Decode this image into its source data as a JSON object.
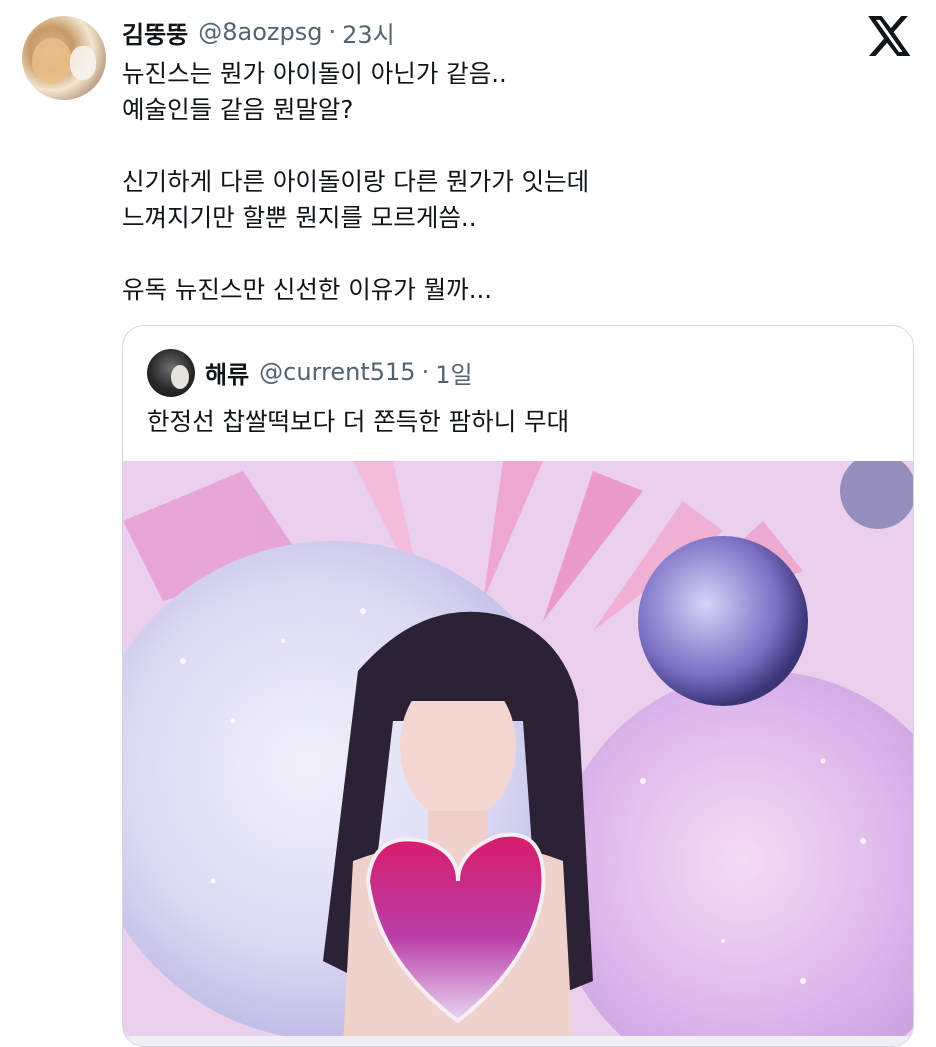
{
  "tweet": {
    "author_name": "김뚱뚱",
    "author_handle": "@8aozpsg",
    "separator": "·",
    "time": "23시",
    "text_lines": [
      "뉴진스는 뭔가 아이돌이 아닌가 같음..",
      "예술인들 같음 뭔말알?",
      "",
      "신기하게 다른 아이돌이랑 다른 뭔가가 잇는데",
      "느껴지기만 할뿐 뭔지를 모르게씀..",
      "",
      "유독 뉴진스만 신선한 이유가 뭘까..."
    ]
  },
  "quoted_tweet": {
    "author_name": "해류",
    "author_handle": "@current515",
    "separator": "·",
    "time": "1일",
    "text": "한정선 찹쌀떡보다 더 쫀득한 팜하니 무대"
  },
  "icons": {
    "platform_logo": "x-logo-icon"
  },
  "colors": {
    "text_primary": "#0f1419",
    "text_secondary": "#536471",
    "border": "#cfd9de"
  }
}
